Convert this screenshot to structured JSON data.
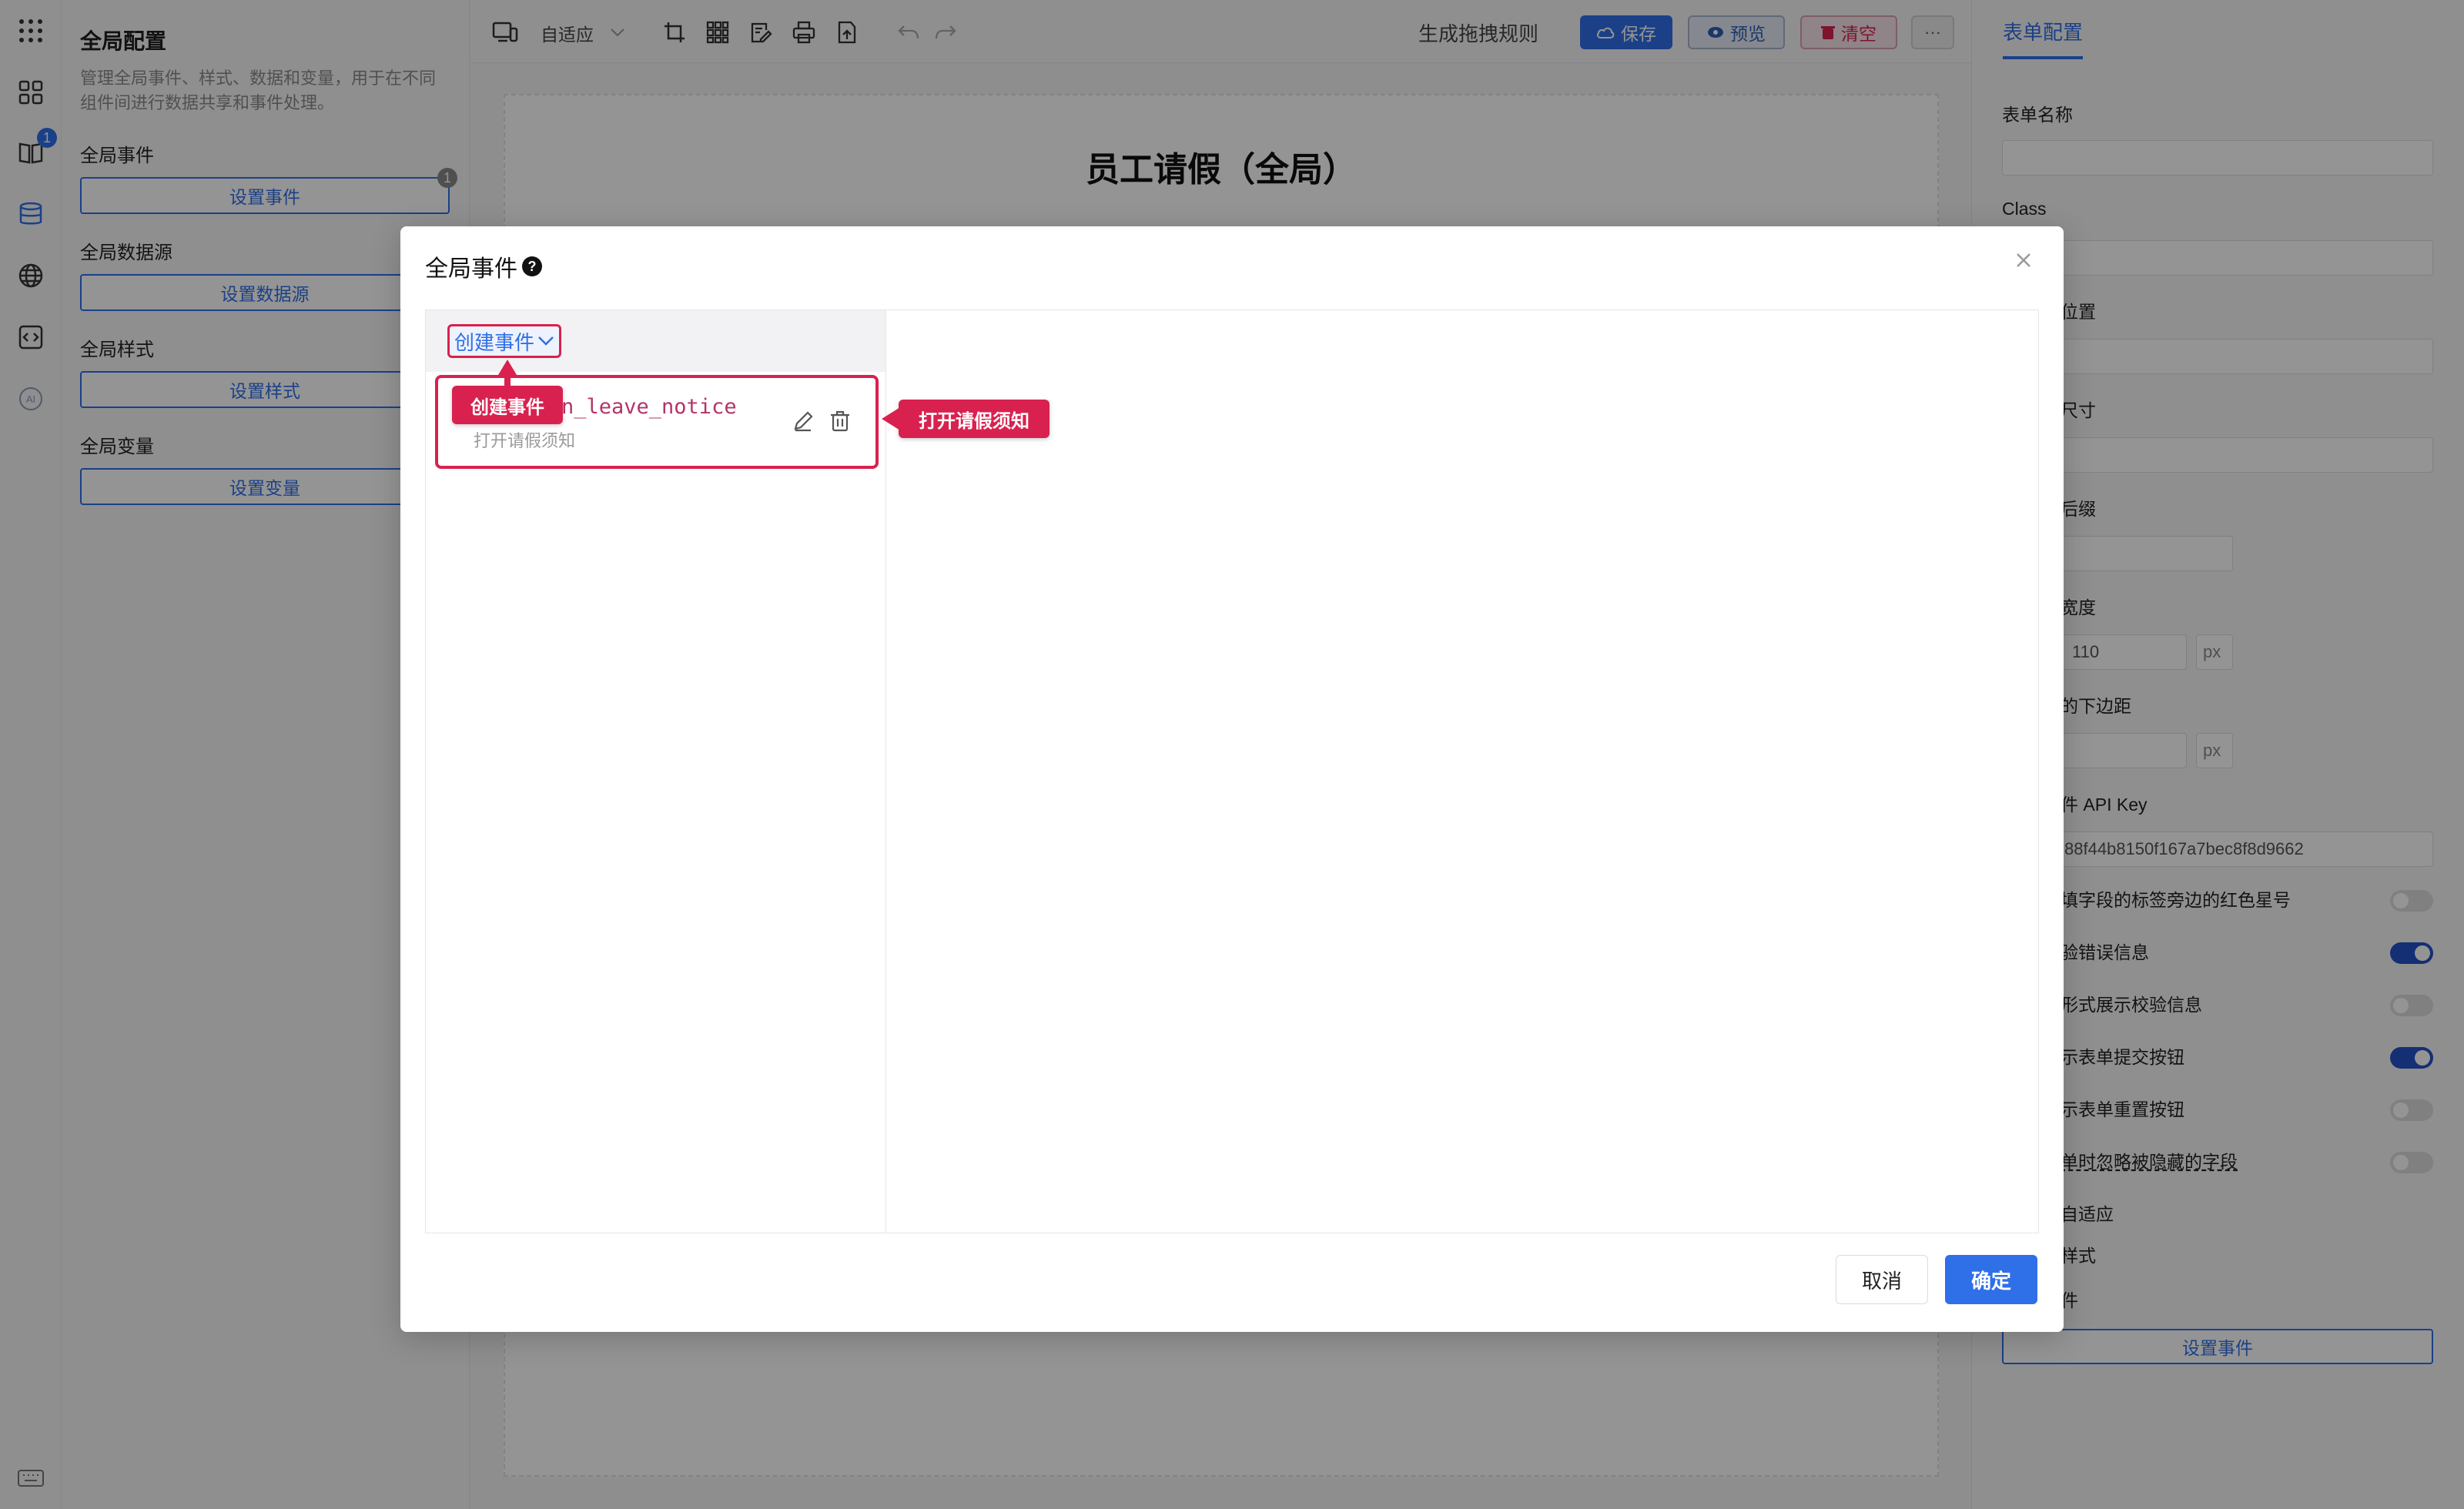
{
  "left_panel": {
    "title": "全局配置",
    "description": "管理全局事件、样式、数据和变量，用于在不同组件间进行数据共享和事件处理。",
    "events_label": "全局事件",
    "events_button": "设置事件",
    "events_count": "1",
    "datasource_label": "全局数据源",
    "datasource_button": "设置数据源",
    "style_label": "全局样式",
    "style_button": "设置样式",
    "variables_label": "全局变量",
    "variables_button": "设置变量"
  },
  "rail": {
    "badge": "1",
    "ai_label": "AI"
  },
  "toolbar": {
    "device_mode": "自适应",
    "generate_rules": "生成拖拽规则",
    "save": "保存",
    "preview": "预览",
    "clear": "清空",
    "more": "···"
  },
  "canvas": {
    "form_title": "员工请假（全局）"
  },
  "right_panel": {
    "tab": "表单配置",
    "form_name_label": "表单名称",
    "form_name_value": "",
    "class_label": "Class",
    "label_position": "位置",
    "label_position_value": "",
    "size_label": "尺寸",
    "size_value": "",
    "suffix_label": "后缀",
    "width_label": "宽度",
    "width_value": "110",
    "width_unit": "px",
    "margin_label": "的下边距",
    "margin_unit": "px",
    "api_key_label": "件 API Key",
    "api_key_value": "88f44b8150f167a7bec8f8d9662",
    "toggles": [
      {
        "label": "填字段的标签旁边的红色星号",
        "on": false
      },
      {
        "label": "验错误信息",
        "on": true
      },
      {
        "label": "形式展示校验信息",
        "on": false
      },
      {
        "label": "示表单提交按钮",
        "on": true
      },
      {
        "label": "示表单重置按钮",
        "on": false
      },
      {
        "label": "单时忽略被隐藏的字段",
        "on": false
      }
    ],
    "adaptive_label": "自适应",
    "style_label": "样式",
    "event_label": "件",
    "events_button": "设置事件"
  },
  "modal": {
    "title": "全局事件",
    "create_event": "创建事件",
    "event_name": "n_leave_notice",
    "event_desc": "打开请假须知",
    "callout_create": "创建事件",
    "callout_open": "打开请假须知",
    "cancel": "取消",
    "ok": "确定"
  },
  "colors": {
    "primary": "#2f6fe8",
    "callout": "#d9214f",
    "toggle_on": "#2452c6"
  }
}
